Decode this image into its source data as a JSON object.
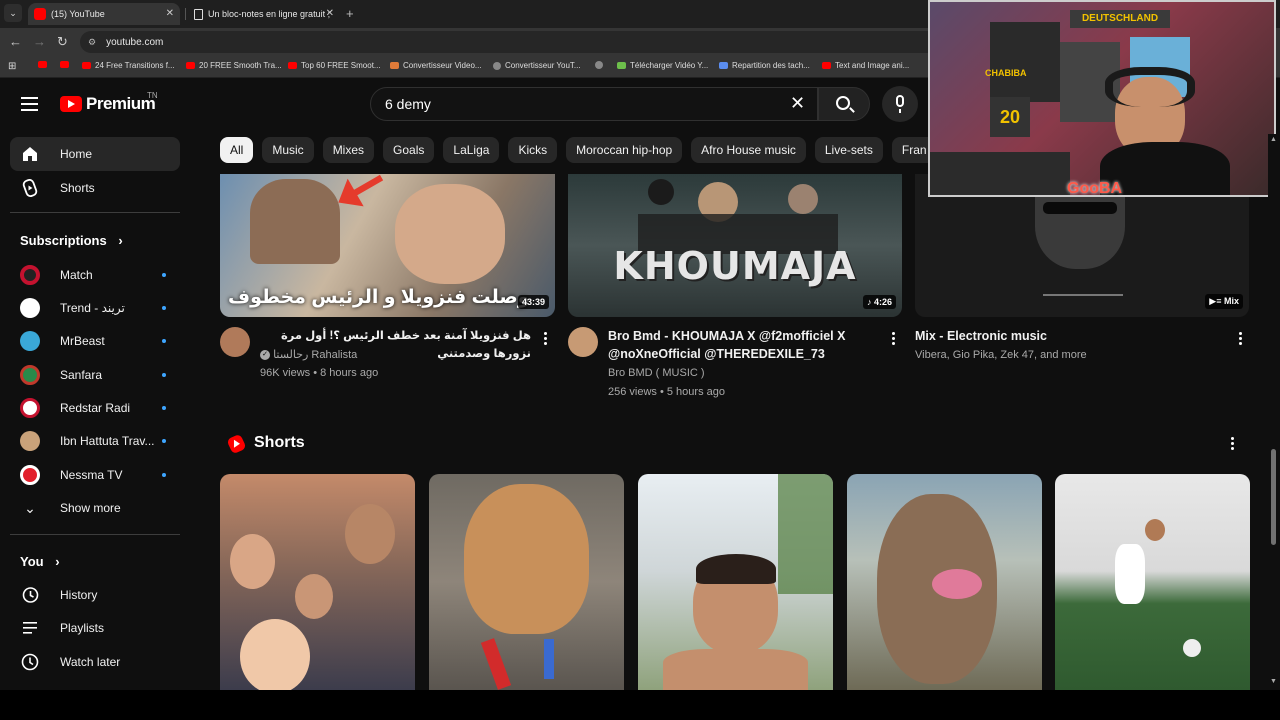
{
  "browser": {
    "tabs": [
      {
        "title": "(15) YouTube",
        "active": true
      },
      {
        "title": "Un bloc-notes en ligne gratuit ;",
        "active": false
      }
    ],
    "url": "youtube.com",
    "bookmarks": [
      "24 Free Transitions f...",
      "20 FREE Smooth Tra...",
      "Top 60 FREE Smoot...",
      "Convertisseur Video...",
      "Convertisseur YouT...",
      "Télécharger Vidéo Y...",
      "Repartition des tach...",
      "Text and Image ani..."
    ]
  },
  "header": {
    "logo_text": "Premium",
    "country_code": "TN",
    "search_query": "6 demy"
  },
  "sidebar": {
    "main": [
      {
        "label": "Home",
        "icon": "home-icon",
        "active": true
      },
      {
        "label": "Shorts",
        "icon": "shorts-icon",
        "active": false
      }
    ],
    "subscriptions_heading": "Subscriptions",
    "subscriptions": [
      {
        "label": "Match",
        "color": "#c4122f"
      },
      {
        "label": "Trend - تريند",
        "color": "#ffffff"
      },
      {
        "label": "MrBeast",
        "color": "#3aa8d8"
      },
      {
        "label": "Sanfara",
        "color": "#2a8a4a"
      },
      {
        "label": "Redstar Radi",
        "color": "#ffffff"
      },
      {
        "label": "Ibn Hattuta Trav...",
        "color": "#c9a27a"
      },
      {
        "label": "Nessma TV",
        "color": "#e2202c"
      }
    ],
    "show_more": "Show more",
    "you_heading": "You",
    "you_items": [
      {
        "label": "History",
        "icon": "history-icon"
      },
      {
        "label": "Playlists",
        "icon": "playlists-icon"
      },
      {
        "label": "Watch later",
        "icon": "watch-later-icon"
      }
    ]
  },
  "chips": [
    "All",
    "Music",
    "Mixes",
    "Goals",
    "LaLiga",
    "Kicks",
    "Moroccan hip-hop",
    "Afro House music",
    "Live-sets",
    "Fran"
  ],
  "videos": [
    {
      "title": "هل فنزويلا آمنة بعد خطف الرئيس ؟! أول مرة نزورها وصدمتني",
      "channel": "رحالستا Rahalista",
      "meta": "96K views • 8 hours ago",
      "duration": "43:39",
      "overlay_text": "وصلت فنزويلا و الرئيس مخطوف"
    },
    {
      "title_line1": "Bro Bmd - KHOUMAJA X @f2mofficiel X",
      "title_line2": "@noXneOfficial @THEREDEXILE_73",
      "channel": "Bro BMD ( MUSIC )",
      "meta": "256 views • 5 hours ago",
      "duration": "4:26",
      "overlay_text": "KHOUMAJA"
    },
    {
      "title": "Mix - Electronic music",
      "channel": "Vibera, Gio Pika, Zek 47, and more",
      "badge": "Mix"
    }
  ],
  "shorts": {
    "title": "Shorts"
  },
  "webcam": {
    "streamer_tag": "GooBA",
    "banner_text": "DEUTSCHLAND",
    "jersey_number": "20",
    "sign_text": "CHABIBA"
  }
}
